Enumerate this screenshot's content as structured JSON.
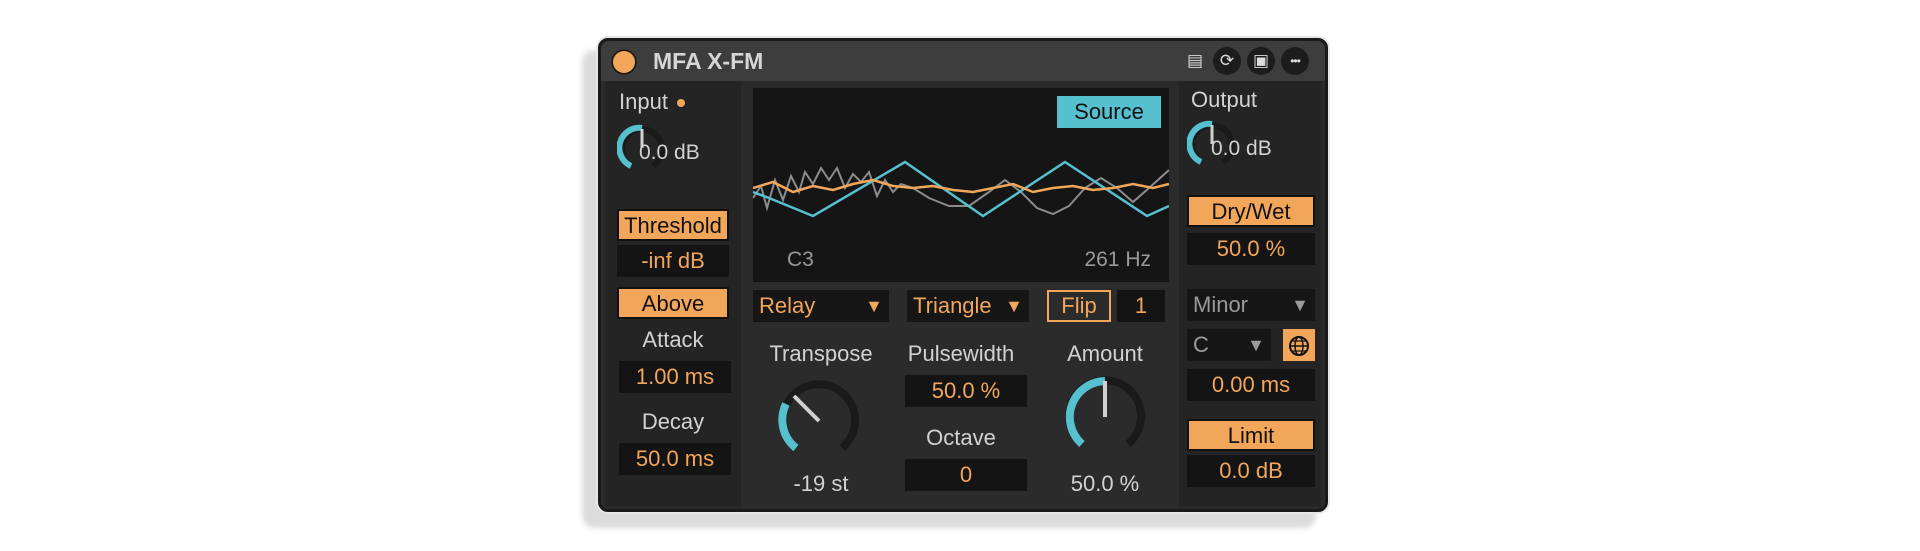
{
  "device": {
    "title": "MFA X-FM"
  },
  "titlebar_icons": [
    {
      "icon": "clip-icon",
      "glyph": "▤"
    },
    {
      "icon": "sync-icon",
      "glyph": "⟳"
    },
    {
      "icon": "save-icon",
      "glyph": "▣"
    },
    {
      "icon": "more-icon",
      "glyph": "•••"
    }
  ],
  "input": {
    "label": "Input",
    "value": "0.0 dB",
    "threshold_label": "Threshold",
    "threshold_value": "-inf dB",
    "mode_label": "Above",
    "attack_label": "Attack",
    "attack_value": "1.00 ms",
    "decay_label": "Decay",
    "decay_value": "50.0 ms"
  },
  "scope": {
    "source_label": "Source",
    "note": "C3",
    "freq": "261 Hz"
  },
  "controls": {
    "mode": "Relay",
    "wave": "Triangle",
    "flip_label": "Flip",
    "flip_value": "1",
    "transpose_label": "Transpose",
    "transpose_value": "-19 st",
    "pulsewidth_label": "Pulsewidth",
    "pulsewidth_value": "50.0 %",
    "octave_label": "Octave",
    "octave_value": "0",
    "amount_label": "Amount",
    "amount_value": "50.0 %"
  },
  "output": {
    "label": "Output",
    "value": "0.0 dB",
    "drywet_label": "Dry/Wet",
    "drywet_value": "50.0 %",
    "scale": "Minor",
    "key": "C",
    "time_value": "0.00 ms",
    "limit_label": "Limit",
    "limit_value": "0.0 dB"
  },
  "colors": {
    "accent": "#f2a65a",
    "cyan": "#56c0cf",
    "bg": "#2b2b2b"
  }
}
